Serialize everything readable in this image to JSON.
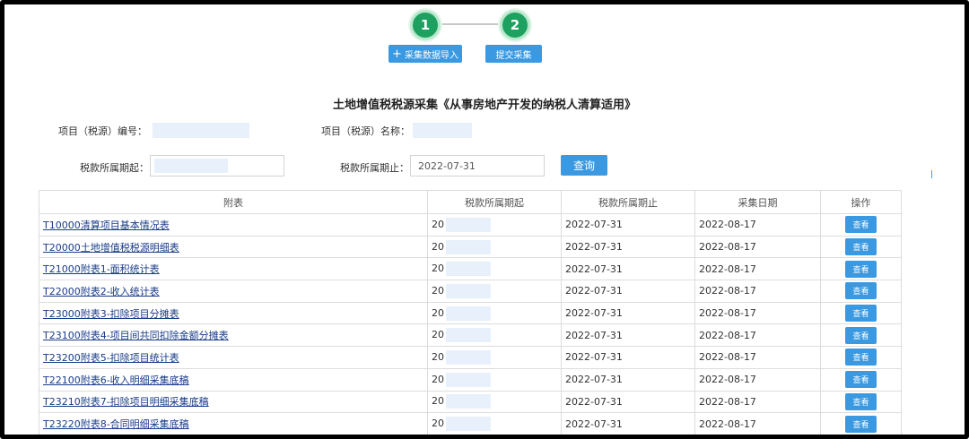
{
  "steps": {
    "one": "1",
    "two": "2"
  },
  "actions": {
    "import_plus": "+",
    "import_label": "采集数据导入",
    "submit_label": "提交采集",
    "query_label": "查询"
  },
  "title": "土地增值税税源采集《从事房地产开发的纳税人清算适用》",
  "filters": {
    "project_code_label": "项目（税源）编号：",
    "project_name_label": "项目（税源）名称：",
    "period_start_label": "税款所属期起：",
    "period_end_label": "税款所属期止：",
    "period_end_value": "2022-07-31"
  },
  "table": {
    "headers": [
      "附表",
      "税款所属期起",
      "税款所属期止",
      "采集日期",
      "操作"
    ],
    "rows": [
      {
        "name": "T10000清算项目基本情况表",
        "start": "20",
        "end": "2022-07-31",
        "date": "2022-08-17",
        "op": "查看"
      },
      {
        "name": "T20000土地增值税税源明细表",
        "start": "20",
        "end": "2022-07-31",
        "date": "2022-08-17",
        "op": "查看"
      },
      {
        "name": "T21000附表1-面积统计表",
        "start": "20",
        "end": "2022-07-31",
        "date": "2022-08-17",
        "op": "查看"
      },
      {
        "name": "T22000附表2-收入统计表",
        "start": "20",
        "end": "2022-07-31",
        "date": "2022-08-17",
        "op": "查看"
      },
      {
        "name": "T23000附表3-扣除项目分摊表",
        "start": "20",
        "end": "2022-07-31",
        "date": "2022-08-17",
        "op": "查看"
      },
      {
        "name": "T23100附表4-项目间共同扣除金额分摊表",
        "start": "20",
        "end": "2022-07-31",
        "date": "2022-08-17",
        "op": "查看"
      },
      {
        "name": "T23200附表5-扣除项目统计表",
        "start": "20",
        "end": "2022-07-31",
        "date": "2022-08-17",
        "op": "查看"
      },
      {
        "name": "T22100附表6-收入明细采集底稿",
        "start": "20",
        "end": "2022-07-31",
        "date": "2022-08-17",
        "op": "查看"
      },
      {
        "name": "T23210附表7-扣除项目明细采集底稿",
        "start": "20",
        "end": "2022-07-31",
        "date": "2022-08-17",
        "op": "查看"
      },
      {
        "name": "T23220附表8-合同明细采集底稿",
        "start": "20",
        "end": "2022-07-31",
        "date": "2022-08-17",
        "op": "查看"
      }
    ]
  }
}
